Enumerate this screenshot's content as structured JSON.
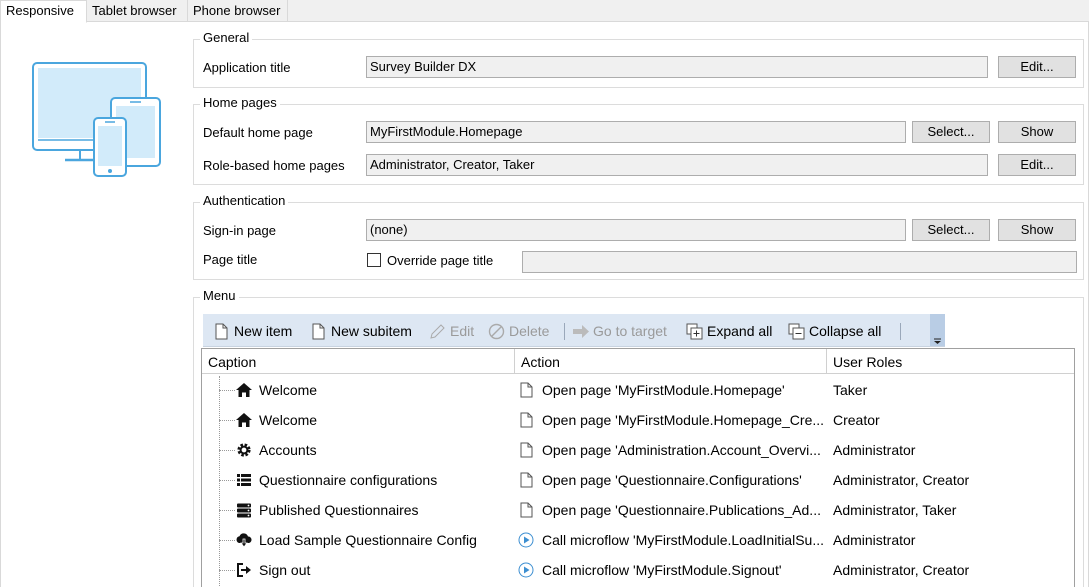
{
  "tabs": [
    {
      "label": "Responsive",
      "active": true
    },
    {
      "label": "Tablet browser",
      "active": false
    },
    {
      "label": "Phone browser",
      "active": false
    }
  ],
  "general": {
    "title": "General",
    "app_title_label": "Application title",
    "app_title_value": "Survey Builder DX",
    "edit_label": "Edit..."
  },
  "home_pages": {
    "title": "Home pages",
    "default_label": "Default home page",
    "default_value": "MyFirstModule.Homepage",
    "select_label": "Select...",
    "show_label": "Show",
    "role_label": "Role-based home pages",
    "role_value": "Administrator, Creator, Taker",
    "edit_label": "Edit..."
  },
  "authentication": {
    "title": "Authentication",
    "signin_label": "Sign-in page",
    "signin_value": "(none)",
    "select_label": "Select...",
    "show_label": "Show",
    "page_title_label": "Page title",
    "override_label": "Override page title",
    "override_checked": false,
    "page_title_value": ""
  },
  "menu": {
    "title": "Menu",
    "toolbar": {
      "new_item": "New item",
      "new_subitem": "New subitem",
      "edit": "Edit",
      "delete": "Delete",
      "go_to_target": "Go to target",
      "expand_all": "Expand all",
      "collapse_all": "Collapse all"
    },
    "columns": [
      "Caption",
      "Action",
      "User Roles"
    ],
    "rows": [
      {
        "icon": "home-icon",
        "caption": "Welcome",
        "action_icon": "page-icon",
        "action": "Open page 'MyFirstModule.Homepage'",
        "roles": "Taker"
      },
      {
        "icon": "home-icon",
        "caption": "Welcome",
        "action_icon": "page-icon",
        "action": "Open page 'MyFirstModule.Homepage_Cre...",
        "roles": "Creator"
      },
      {
        "icon": "gear-icon",
        "caption": "Accounts",
        "action_icon": "page-icon",
        "action": "Open page 'Administration.Account_Overvi...",
        "roles": "Administrator"
      },
      {
        "icon": "list-icon",
        "caption": "Questionnaire configurations",
        "action_icon": "page-icon",
        "action": "Open page 'Questionnaire.Configurations'",
        "roles": "Administrator, Creator"
      },
      {
        "icon": "server-icon",
        "caption": "Published Questionnaires",
        "action_icon": "page-icon",
        "action": "Open page 'Questionnaire.Publications_Ad...",
        "roles": "Administrator, Taker"
      },
      {
        "icon": "cloud-download-icon",
        "caption": "Load Sample Questionnaire Config",
        "action_icon": "microflow-icon",
        "action": "Call  microflow 'MyFirstModule.LoadInitialSu...",
        "roles": "Administrator"
      },
      {
        "icon": "sign-out-icon",
        "caption": "Sign out",
        "action_icon": "microflow-icon",
        "action": "Call microflow 'MyFirstModule.Signout'",
        "roles": "Administrator, Creator"
      }
    ]
  }
}
